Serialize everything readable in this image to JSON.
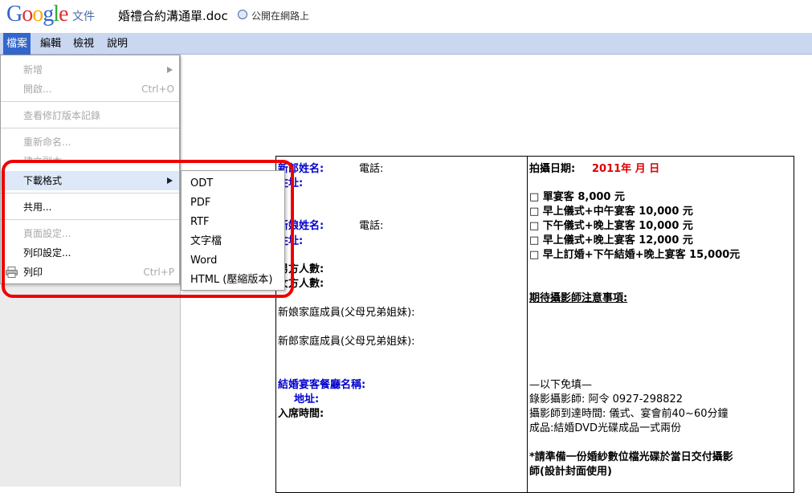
{
  "header": {
    "logo": "Google",
    "logo_colors": [
      "#3366cc",
      "#dd3333",
      "#ffaa00",
      "#3366cc",
      "#33aa33",
      "#dd3333"
    ],
    "product": "文件",
    "doc_title": "婚禮合約溝通單.doc",
    "share_status": "公開在網路上"
  },
  "menubar": {
    "items": [
      "檔案",
      "編輯",
      "檢視",
      "說明"
    ]
  },
  "file_menu": {
    "items": [
      {
        "label": "新增",
        "shortcut": "",
        "disabled": true,
        "submenu": true
      },
      {
        "label": "開啟...",
        "shortcut": "Ctrl+O",
        "disabled": true
      },
      {
        "label": "查看修訂版本記錄",
        "shortcut": "",
        "disabled": true
      },
      {
        "label": "重新命名...",
        "shortcut": "",
        "disabled": true
      },
      {
        "label": "建立副本",
        "shortcut": "",
        "disabled": true
      },
      {
        "label": "下載格式",
        "shortcut": "",
        "disabled": false,
        "submenu": true
      },
      {
        "label": "共用...",
        "shortcut": "",
        "disabled": false
      },
      {
        "label": "頁面設定...",
        "shortcut": "",
        "disabled": true
      },
      {
        "label": "列印設定...",
        "shortcut": "",
        "disabled": false
      },
      {
        "label": "列印",
        "shortcut": "Ctrl+P",
        "disabled": false
      }
    ]
  },
  "download_submenu": {
    "items": [
      "ODT",
      "PDF",
      "RTF",
      "文字檔",
      "Word",
      "HTML (壓縮版本)"
    ]
  },
  "document": {
    "groom_name": "新郎姓名:",
    "phone": "電話:",
    "address": "住址:",
    "bride_name": "新娘姓名:",
    "groom_side": "男方人數:",
    "bride_side": "女方人數:",
    "bride_family": "新娘家庭成員(父母兄弟姐妹):",
    "groom_family": "新郎家庭成員(父母兄弟姐妹):",
    "venue_name": "結婚宴客餐廳名稱:",
    "venue_address": "地址:",
    "seating_time": "入席時間:",
    "shoot_date_label": "拍攝日期:",
    "shoot_date_value": "2011年 月 日",
    "packages": [
      "□ 單宴客 8,000 元",
      "□ 早上儀式+中午宴客 10,000 元",
      "□ 下午儀式+晚上宴客 10,000 元",
      "□ 早上儀式+晚上宴客 12,000 元",
      "□ 早上訂婚+下午結婚+晚上宴客 15,000元"
    ],
    "notes_heading": "期待攝影師注意事項:",
    "free_fill": "—以下免填—",
    "videographer": "錄影攝影師: 阿令 0927-298822",
    "arrival_time": "攝影師到達時間: 儀式、宴會前40~60分鐘",
    "product": "成品:結婚DVD光碟成品一式兩份",
    "reminder_line1": "*請準備一份婚紗數位檔光碟於當日交付攝影",
    "reminder_line2": "師(設計封面使用)"
  }
}
